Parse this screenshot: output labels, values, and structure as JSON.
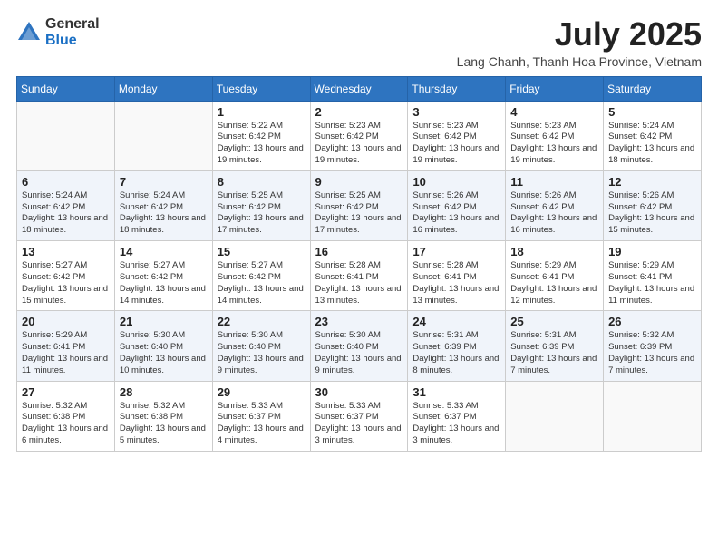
{
  "logo": {
    "general": "General",
    "blue": "Blue"
  },
  "title": "July 2025",
  "subtitle": "Lang Chanh, Thanh Hoa Province, Vietnam",
  "weekdays": [
    "Sunday",
    "Monday",
    "Tuesday",
    "Wednesday",
    "Thursday",
    "Friday",
    "Saturday"
  ],
  "weeks": [
    [
      {
        "day": null,
        "sunrise": null,
        "sunset": null,
        "daylight": null
      },
      {
        "day": null,
        "sunrise": null,
        "sunset": null,
        "daylight": null
      },
      {
        "day": "1",
        "sunrise": "Sunrise: 5:22 AM",
        "sunset": "Sunset: 6:42 PM",
        "daylight": "Daylight: 13 hours and 19 minutes."
      },
      {
        "day": "2",
        "sunrise": "Sunrise: 5:23 AM",
        "sunset": "Sunset: 6:42 PM",
        "daylight": "Daylight: 13 hours and 19 minutes."
      },
      {
        "day": "3",
        "sunrise": "Sunrise: 5:23 AM",
        "sunset": "Sunset: 6:42 PM",
        "daylight": "Daylight: 13 hours and 19 minutes."
      },
      {
        "day": "4",
        "sunrise": "Sunrise: 5:23 AM",
        "sunset": "Sunset: 6:42 PM",
        "daylight": "Daylight: 13 hours and 19 minutes."
      },
      {
        "day": "5",
        "sunrise": "Sunrise: 5:24 AM",
        "sunset": "Sunset: 6:42 PM",
        "daylight": "Daylight: 13 hours and 18 minutes."
      }
    ],
    [
      {
        "day": "6",
        "sunrise": "Sunrise: 5:24 AM",
        "sunset": "Sunset: 6:42 PM",
        "daylight": "Daylight: 13 hours and 18 minutes."
      },
      {
        "day": "7",
        "sunrise": "Sunrise: 5:24 AM",
        "sunset": "Sunset: 6:42 PM",
        "daylight": "Daylight: 13 hours and 18 minutes."
      },
      {
        "day": "8",
        "sunrise": "Sunrise: 5:25 AM",
        "sunset": "Sunset: 6:42 PM",
        "daylight": "Daylight: 13 hours and 17 minutes."
      },
      {
        "day": "9",
        "sunrise": "Sunrise: 5:25 AM",
        "sunset": "Sunset: 6:42 PM",
        "daylight": "Daylight: 13 hours and 17 minutes."
      },
      {
        "day": "10",
        "sunrise": "Sunrise: 5:26 AM",
        "sunset": "Sunset: 6:42 PM",
        "daylight": "Daylight: 13 hours and 16 minutes."
      },
      {
        "day": "11",
        "sunrise": "Sunrise: 5:26 AM",
        "sunset": "Sunset: 6:42 PM",
        "daylight": "Daylight: 13 hours and 16 minutes."
      },
      {
        "day": "12",
        "sunrise": "Sunrise: 5:26 AM",
        "sunset": "Sunset: 6:42 PM",
        "daylight": "Daylight: 13 hours and 15 minutes."
      }
    ],
    [
      {
        "day": "13",
        "sunrise": "Sunrise: 5:27 AM",
        "sunset": "Sunset: 6:42 PM",
        "daylight": "Daylight: 13 hours and 15 minutes."
      },
      {
        "day": "14",
        "sunrise": "Sunrise: 5:27 AM",
        "sunset": "Sunset: 6:42 PM",
        "daylight": "Daylight: 13 hours and 14 minutes."
      },
      {
        "day": "15",
        "sunrise": "Sunrise: 5:27 AM",
        "sunset": "Sunset: 6:42 PM",
        "daylight": "Daylight: 13 hours and 14 minutes."
      },
      {
        "day": "16",
        "sunrise": "Sunrise: 5:28 AM",
        "sunset": "Sunset: 6:41 PM",
        "daylight": "Daylight: 13 hours and 13 minutes."
      },
      {
        "day": "17",
        "sunrise": "Sunrise: 5:28 AM",
        "sunset": "Sunset: 6:41 PM",
        "daylight": "Daylight: 13 hours and 13 minutes."
      },
      {
        "day": "18",
        "sunrise": "Sunrise: 5:29 AM",
        "sunset": "Sunset: 6:41 PM",
        "daylight": "Daylight: 13 hours and 12 minutes."
      },
      {
        "day": "19",
        "sunrise": "Sunrise: 5:29 AM",
        "sunset": "Sunset: 6:41 PM",
        "daylight": "Daylight: 13 hours and 11 minutes."
      }
    ],
    [
      {
        "day": "20",
        "sunrise": "Sunrise: 5:29 AM",
        "sunset": "Sunset: 6:41 PM",
        "daylight": "Daylight: 13 hours and 11 minutes."
      },
      {
        "day": "21",
        "sunrise": "Sunrise: 5:30 AM",
        "sunset": "Sunset: 6:40 PM",
        "daylight": "Daylight: 13 hours and 10 minutes."
      },
      {
        "day": "22",
        "sunrise": "Sunrise: 5:30 AM",
        "sunset": "Sunset: 6:40 PM",
        "daylight": "Daylight: 13 hours and 9 minutes."
      },
      {
        "day": "23",
        "sunrise": "Sunrise: 5:30 AM",
        "sunset": "Sunset: 6:40 PM",
        "daylight": "Daylight: 13 hours and 9 minutes."
      },
      {
        "day": "24",
        "sunrise": "Sunrise: 5:31 AM",
        "sunset": "Sunset: 6:39 PM",
        "daylight": "Daylight: 13 hours and 8 minutes."
      },
      {
        "day": "25",
        "sunrise": "Sunrise: 5:31 AM",
        "sunset": "Sunset: 6:39 PM",
        "daylight": "Daylight: 13 hours and 7 minutes."
      },
      {
        "day": "26",
        "sunrise": "Sunrise: 5:32 AM",
        "sunset": "Sunset: 6:39 PM",
        "daylight": "Daylight: 13 hours and 7 minutes."
      }
    ],
    [
      {
        "day": "27",
        "sunrise": "Sunrise: 5:32 AM",
        "sunset": "Sunset: 6:38 PM",
        "daylight": "Daylight: 13 hours and 6 minutes."
      },
      {
        "day": "28",
        "sunrise": "Sunrise: 5:32 AM",
        "sunset": "Sunset: 6:38 PM",
        "daylight": "Daylight: 13 hours and 5 minutes."
      },
      {
        "day": "29",
        "sunrise": "Sunrise: 5:33 AM",
        "sunset": "Sunset: 6:37 PM",
        "daylight": "Daylight: 13 hours and 4 minutes."
      },
      {
        "day": "30",
        "sunrise": "Sunrise: 5:33 AM",
        "sunset": "Sunset: 6:37 PM",
        "daylight": "Daylight: 13 hours and 3 minutes."
      },
      {
        "day": "31",
        "sunrise": "Sunrise: 5:33 AM",
        "sunset": "Sunset: 6:37 PM",
        "daylight": "Daylight: 13 hours and 3 minutes."
      },
      {
        "day": null,
        "sunrise": null,
        "sunset": null,
        "daylight": null
      },
      {
        "day": null,
        "sunrise": null,
        "sunset": null,
        "daylight": null
      }
    ]
  ]
}
